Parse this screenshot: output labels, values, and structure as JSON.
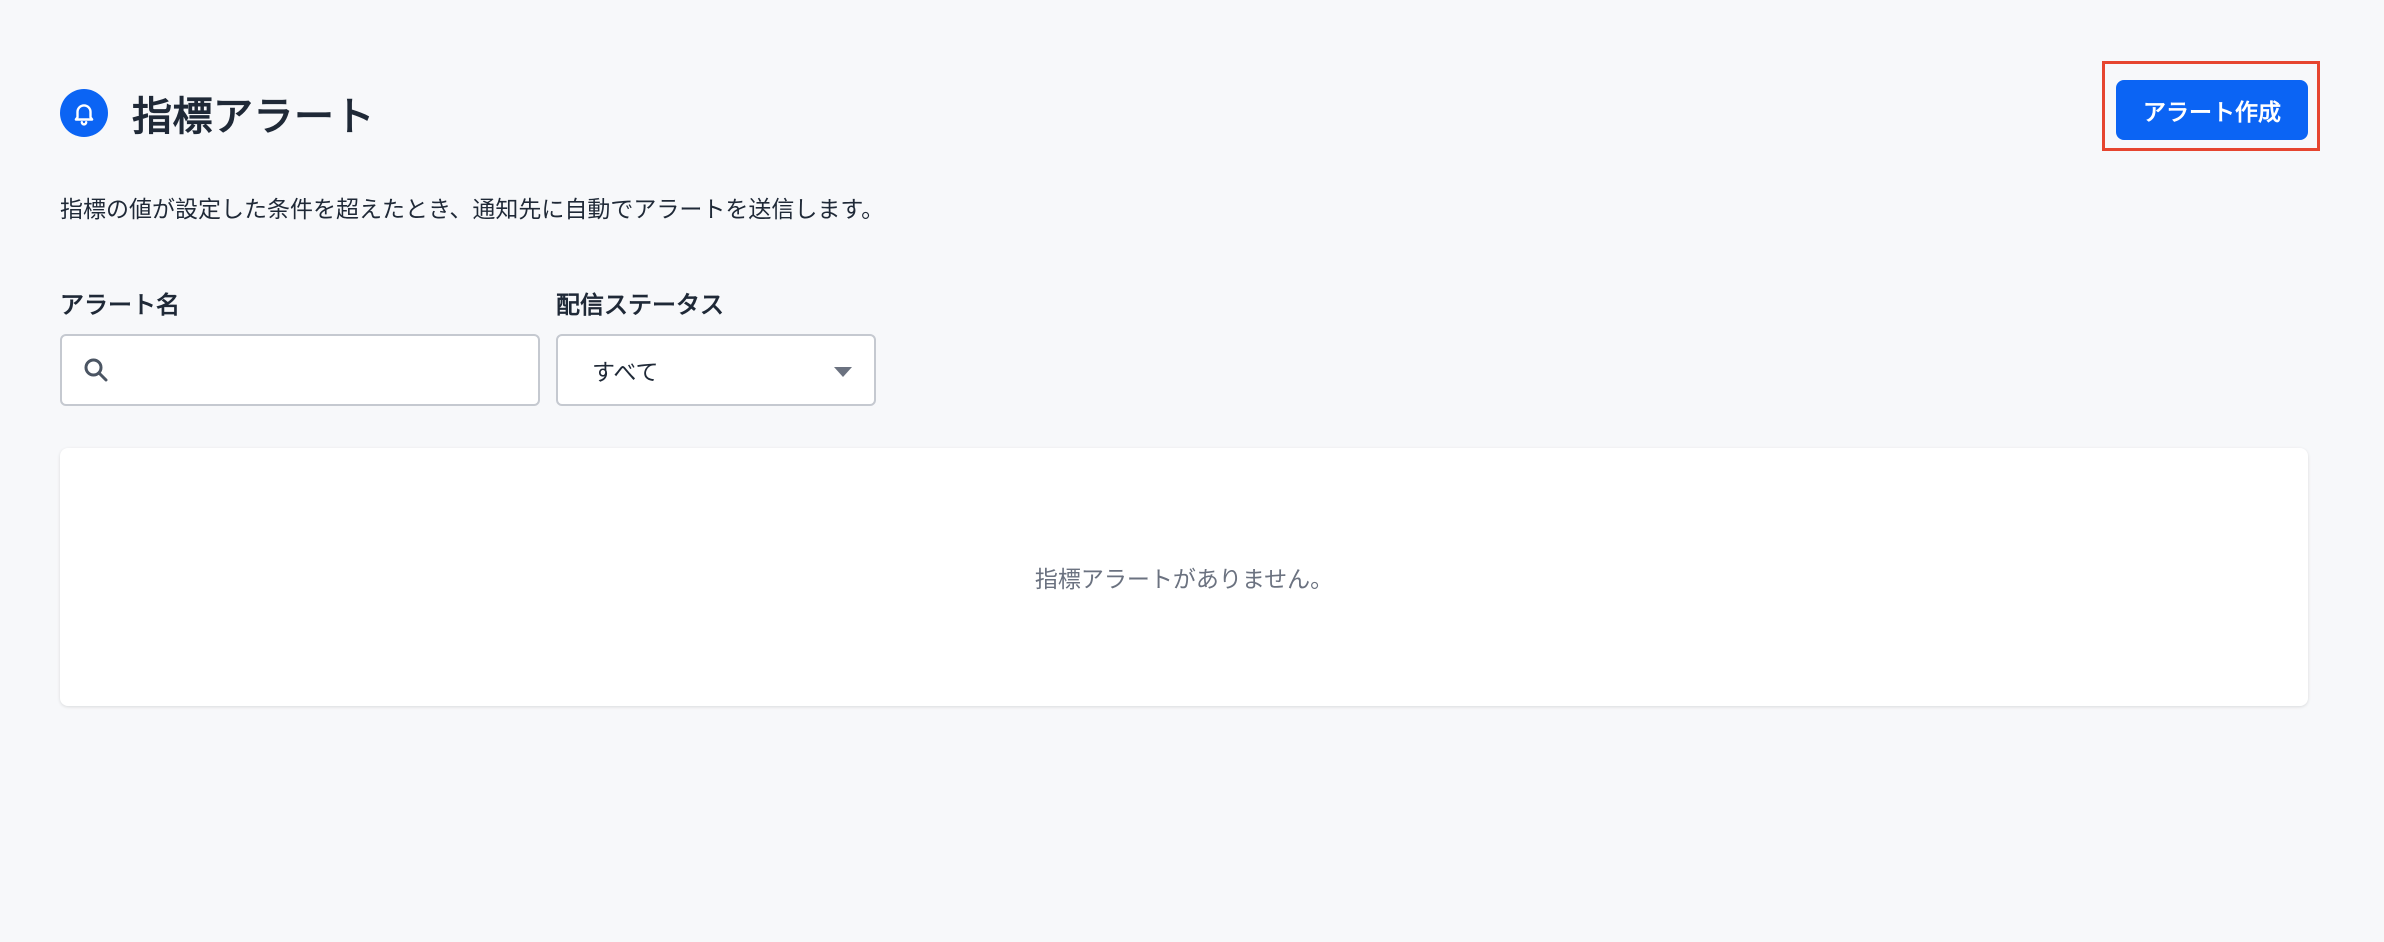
{
  "header": {
    "icon": "bell-icon",
    "title": "指標アラート",
    "create_button_label": "アラート作成"
  },
  "description": "指標の値が設定した条件を超えたとき、通知先に自動でアラートを送信します。",
  "filters": {
    "name_label": "アラート名",
    "name_value": "",
    "name_icon": "search-icon",
    "status_label": "配信ステータス",
    "status_selected": "すべて"
  },
  "empty_state": {
    "message": "指標アラートがありません。"
  },
  "colors": {
    "accent": "#0b64f4",
    "highlight": "#e6452f",
    "background": "#f7f8fa"
  }
}
